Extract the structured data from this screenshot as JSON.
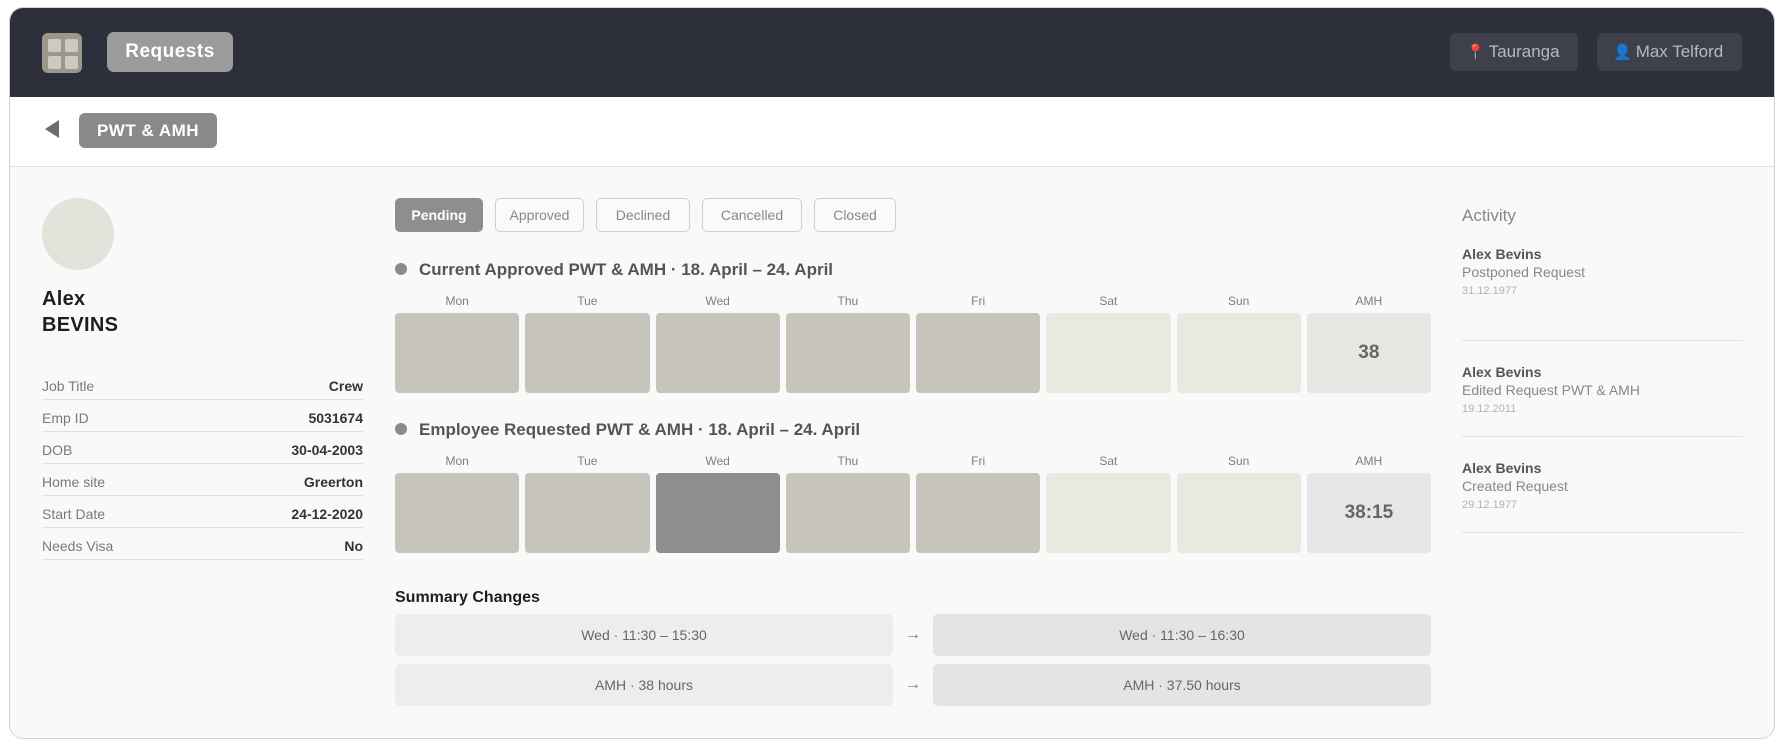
{
  "topbar": {
    "app_title": "Requests",
    "location": "Tauranga",
    "location_icon": "map-pin-icon",
    "user": "Max Telford",
    "user_icon": "user-icon"
  },
  "subbar": {
    "breadcrumb": "PWT & AMH"
  },
  "profile": {
    "first_name": "Alex",
    "last_name": "BEVINS",
    "fields": [
      {
        "label": "Job Title",
        "value": "Crew"
      },
      {
        "label": "Emp ID",
        "value": "5031674"
      },
      {
        "label": "DOB",
        "value": "30-04-2003"
      },
      {
        "label": "Home site",
        "value": "Greerton"
      },
      {
        "label": "Start Date",
        "value": "24-12-2020"
      },
      {
        "label": "Needs Visa",
        "value": "No"
      }
    ]
  },
  "status_tabs": [
    "Pending",
    "Approved",
    "Declined",
    "Cancelled",
    "Closed"
  ],
  "current": {
    "title": "Current Approved PWT & AMH · 18. April – 24. April",
    "days": [
      "Mon",
      "Tue",
      "Wed",
      "Thu",
      "Fri",
      "Sat",
      "Sun",
      "AMH"
    ],
    "amh": "38"
  },
  "requested": {
    "title": "Employee Requested PWT & AMH · 18. April – 24. April",
    "days": [
      "Mon",
      "Tue",
      "Wed",
      "Thu",
      "Fri",
      "Sat",
      "Sun",
      "AMH"
    ],
    "amh": "38:15"
  },
  "summary": {
    "title": "Summary Changes",
    "rows": [
      {
        "from": "Wed · 11:30 – 15:30",
        "to": "Wed · 11:30 – 16:30"
      },
      {
        "from": "AMH · 38 hours",
        "to": "AMH · 37.50 hours"
      }
    ],
    "arrow": "→"
  },
  "activity": {
    "title": "Activity",
    "items": [
      {
        "who": "Alex Bevins",
        "what": "Postponed Request",
        "when": "31.12.1977"
      },
      {
        "who": "Alex Bevins",
        "what": "Edited Request PWT & AMH",
        "when": "19.12.2011"
      },
      {
        "who": "Alex Bevins",
        "what": "Created Request",
        "when": "29.12.1977"
      }
    ]
  }
}
